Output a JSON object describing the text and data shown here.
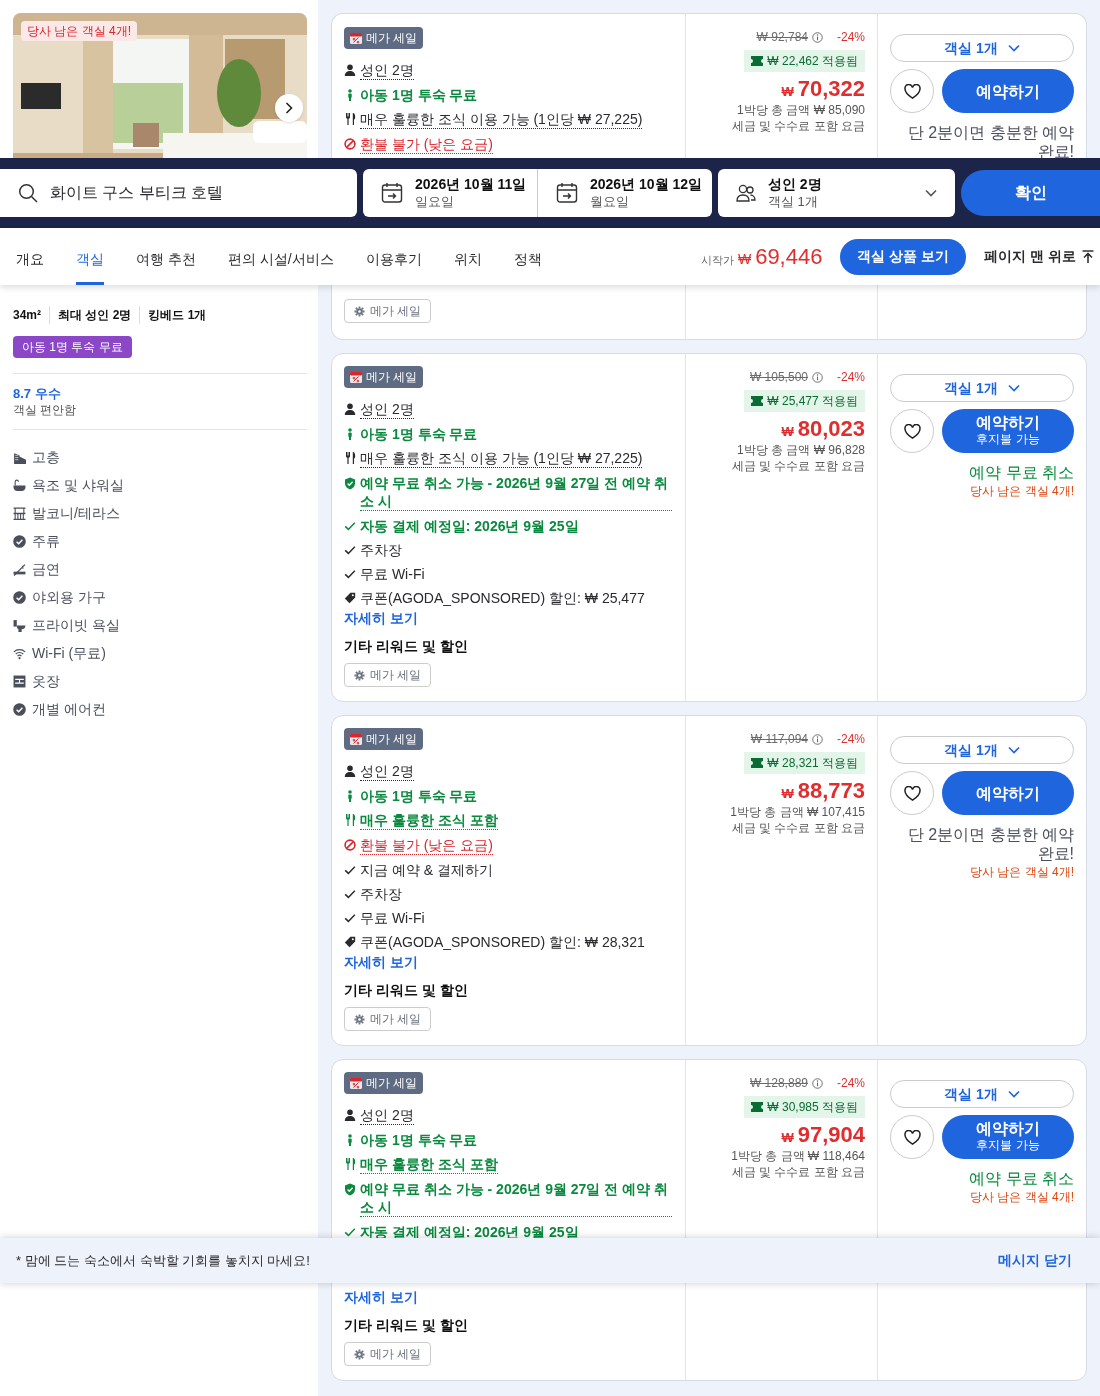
{
  "photo": {
    "badge": "당사 남은 객실 4개!"
  },
  "search": {
    "destination": "화이트 구스 부티크 호텔",
    "check_in": {
      "date": "2026년 10월 11일",
      "weekday": "일요일"
    },
    "check_out": {
      "date": "2026년 10월 12일",
      "weekday": "월요일"
    },
    "guests": {
      "adults": "성인 2명",
      "rooms": "객실 1개"
    },
    "submit": "확인"
  },
  "tabs": [
    {
      "label": "개요",
      "selected": false
    },
    {
      "label": "객실",
      "selected": true
    },
    {
      "label": "여행 추천",
      "selected": false
    },
    {
      "label": "편의 시설/서비스",
      "selected": false
    },
    {
      "label": "이용후기",
      "selected": false
    },
    {
      "label": "위치",
      "selected": false
    },
    {
      "label": "정책",
      "selected": false
    }
  ],
  "price_from": {
    "label": "시작가",
    "currency": "₩",
    "amount": "69,446"
  },
  "view_rooms": "객실 상품 보기",
  "back_to_top": "페이지 맨 위로",
  "room": {
    "specs": [
      "34m²",
      "최대 성인 2명",
      "킹베드 1개"
    ],
    "badge": "아동 1명 투숙 무료",
    "rating": "8.7 우수",
    "rating_note": "객실 편안함",
    "amenities": [
      {
        "kind": "floor",
        "label": "고층"
      },
      {
        "kind": "bath",
        "label": "욕조 및 샤워실"
      },
      {
        "kind": "balcony",
        "label": "발코니/테라스"
      },
      {
        "kind": "check",
        "label": "주류"
      },
      {
        "kind": "nosmoke",
        "label": "금연"
      },
      {
        "kind": "check",
        "label": "야외용 가구"
      },
      {
        "kind": "toilet",
        "label": "프라이빗 욕실"
      },
      {
        "kind": "wifi",
        "label": "Wi-Fi (무료)"
      },
      {
        "kind": "closet",
        "label": "옷장"
      },
      {
        "kind": "check",
        "label": "개별 에어컨"
      }
    ]
  },
  "offers": [
    {
      "badge": "메가 세일",
      "features": [
        {
          "kind": "guests",
          "text": "성인 2명"
        },
        {
          "kind": "kids",
          "text": "아동 1명 투숙 무료"
        },
        {
          "kind": "breakfast_paid",
          "text": "매우 훌륭한 조식 이용 가능 (1인당 ₩ 27,225)"
        },
        {
          "kind": "nonrefund",
          "text": "환불 불가 (낮은 요금)"
        }
      ],
      "reward_chip": "메가 세일",
      "price": {
        "original": "₩ 92,784",
        "discount": "-24%",
        "coupon": "₩ 22,462 적용됨",
        "currency": "₩",
        "amount": "70,322",
        "total": "1박당 총 금액 ₩ 85,090",
        "tax_note": "세금 및 수수료 포함 요금"
      },
      "rooms_select": "객실 1개",
      "book": {
        "label": "예약하기"
      },
      "note": {
        "kind": "quick",
        "text": "단 2분이면 충분한 예약 완료!"
      }
    },
    {
      "badge": "메가 세일",
      "features": [
        {
          "kind": "guests",
          "text": "성인 2명"
        },
        {
          "kind": "kids",
          "text": "아동 1명 투숙 무료"
        },
        {
          "kind": "breakfast_paid",
          "text": "매우 훌륭한 조식 이용 가능 (1인당 ₩ 27,225)"
        },
        {
          "kind": "free_cancel",
          "text": "예약 무료 취소 가능 - 2026년 9월 27일 전 예약 취소 시"
        },
        {
          "kind": "autopay",
          "text": "자동 결제 예정일: 2026년 9월 25일"
        },
        {
          "kind": "check",
          "text": "주차장"
        },
        {
          "kind": "check",
          "text": "무료 Wi-Fi"
        },
        {
          "kind": "coupon",
          "text": "쿠폰(AGODA_SPONSORED) 할인: ₩ 25,477"
        }
      ],
      "more_link": "자세히 보기",
      "rewards_title": "기타 리워드 및 할인",
      "reward_chip": "메가 세일",
      "price": {
        "original": "₩ 105,500",
        "discount": "-24%",
        "coupon": "₩ 25,477 적용됨",
        "currency": "₩",
        "amount": "80,023",
        "total": "1박당 총 금액 ₩ 96,828",
        "tax_note": "세금 및 수수료 포함 요금"
      },
      "rooms_select": "객실 1개",
      "book": {
        "label": "예약하기",
        "sublabel": "후지불 가능"
      },
      "note": {
        "kind": "free_cancel",
        "text": "예약 무료 취소"
      },
      "scarcity": "당사 남은 객실 4개!"
    },
    {
      "badge": "메가 세일",
      "features": [
        {
          "kind": "guests",
          "text": "성인 2명"
        },
        {
          "kind": "kids",
          "text": "아동 1명 투숙 무료"
        },
        {
          "kind": "breakfast_included",
          "text": "매우 훌륭한 조식 포함"
        },
        {
          "kind": "nonrefund",
          "text": "환불 불가 (낮은 요금)"
        },
        {
          "kind": "check",
          "text": "지금 예약 & 결제하기"
        },
        {
          "kind": "check",
          "text": "주차장"
        },
        {
          "kind": "check",
          "text": "무료 Wi-Fi"
        },
        {
          "kind": "coupon",
          "text": "쿠폰(AGODA_SPONSORED) 할인: ₩ 28,321"
        }
      ],
      "more_link": "자세히 보기",
      "rewards_title": "기타 리워드 및 할인",
      "reward_chip": "메가 세일",
      "price": {
        "original": "₩ 117,094",
        "discount": "-24%",
        "coupon": "₩ 28,321 적용됨",
        "currency": "₩",
        "amount": "88,773",
        "total": "1박당 총 금액 ₩ 107,415",
        "tax_note": "세금 및 수수료 포함 요금"
      },
      "rooms_select": "객실 1개",
      "book": {
        "label": "예약하기"
      },
      "note": {
        "kind": "quick",
        "text": "단 2분이면 충분한 예약 완료!"
      },
      "scarcity": "당사 남은 객실 4개!"
    },
    {
      "badge": "메가 세일",
      "features": [
        {
          "kind": "guests",
          "text": "성인 2명"
        },
        {
          "kind": "kids",
          "text": "아동 1명 투숙 무료"
        },
        {
          "kind": "breakfast_included",
          "text": "매우 훌륭한 조식 포함"
        },
        {
          "kind": "free_cancel",
          "text": "예약 무료 취소 가능 - 2026년 9월 27일 전 예약 취소 시"
        },
        {
          "kind": "autopay",
          "text": "자동 결제 예정일: 2026년 9월 25일"
        }
      ],
      "more_link": "자세히 보기",
      "rewards_title": "기타 리워드 및 할인",
      "reward_chip": "메가 세일",
      "price": {
        "original": "₩ 128,889",
        "discount": "-24%",
        "coupon": "₩ 30,985 적용됨",
        "currency": "₩",
        "amount": "97,904",
        "total": "1박당 총 금액 ₩ 118,464",
        "tax_note": "세금 및 수수료 포함 요금"
      },
      "rooms_select": "객실 1개",
      "book": {
        "label": "예약하기",
        "sublabel": "후지불 가능"
      },
      "note": {
        "kind": "free_cancel",
        "text": "예약 무료 취소"
      },
      "scarcity": "당사 남은 객실 4개!"
    }
  ],
  "banner": {
    "message": "* 맘에 드는 숙소에서 숙박할 기회를 놓치지 마세요!",
    "close": "메시지 닫기"
  }
}
